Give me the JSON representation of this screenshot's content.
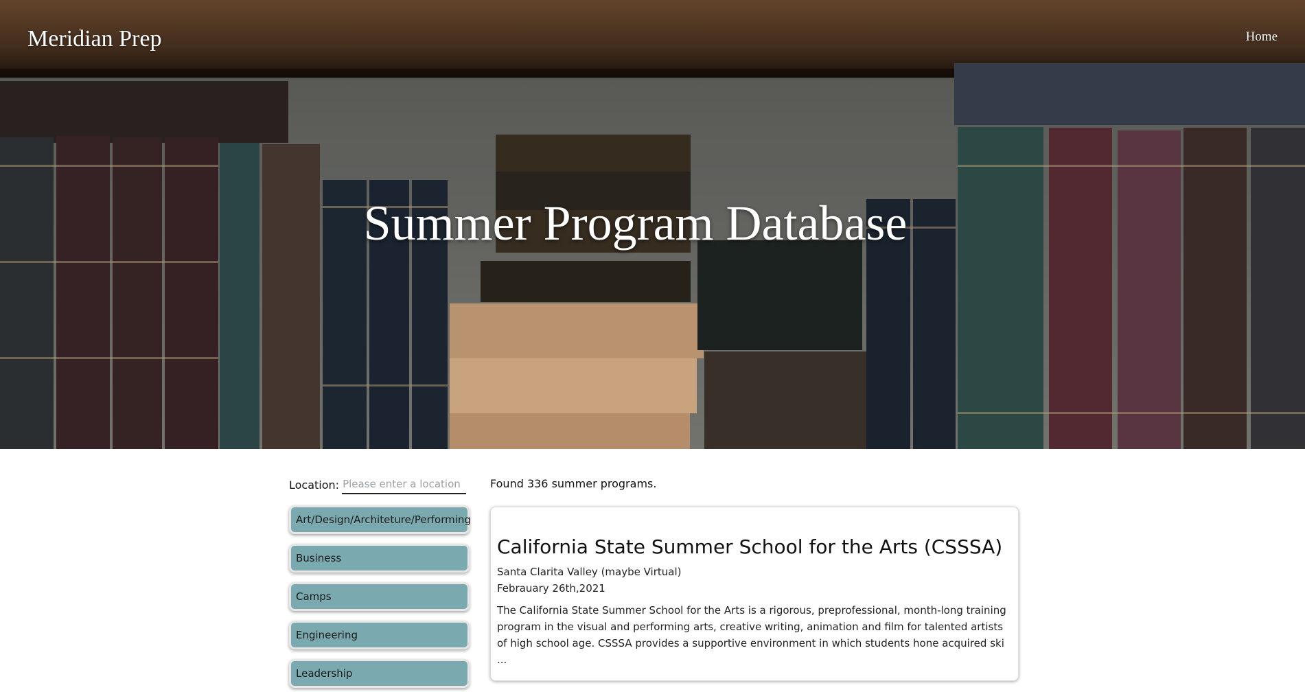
{
  "header": {
    "brand": "Meridian Prep",
    "nav": {
      "home_label": "Home"
    },
    "hero_title": "Summer Program Database"
  },
  "filters": {
    "location_label": "Location:",
    "location_placeholder": "Please enter a location",
    "location_value": "",
    "categories": [
      {
        "label": "Art/Design/Architeture/Performing"
      },
      {
        "label": "Business"
      },
      {
        "label": "Camps"
      },
      {
        "label": "Engineering"
      },
      {
        "label": "Leadership"
      }
    ]
  },
  "results": {
    "summary": "Found 336 summer programs.",
    "items": [
      {
        "title": "California State Summer School for the Arts (CSSSA)",
        "location": "Santa Clarita Valley (maybe Virtual)",
        "deadline": "Febrauary 26th,2021",
        "description": "The California State Summer School for the Arts is a rigorous, preprofessional, month-long training program in the visual and performing arts, creative writing, animation and film for talented artists of high school age. CSSSA provides a supportive environment in which students hone acquired ski ..."
      }
    ]
  },
  "colors": {
    "category_button_bg": "#7aaaaf",
    "hero_text": "#ffffff",
    "page_bg": "#ffffff"
  },
  "icons": {
    "hero_background": "bookshelf-photo"
  }
}
